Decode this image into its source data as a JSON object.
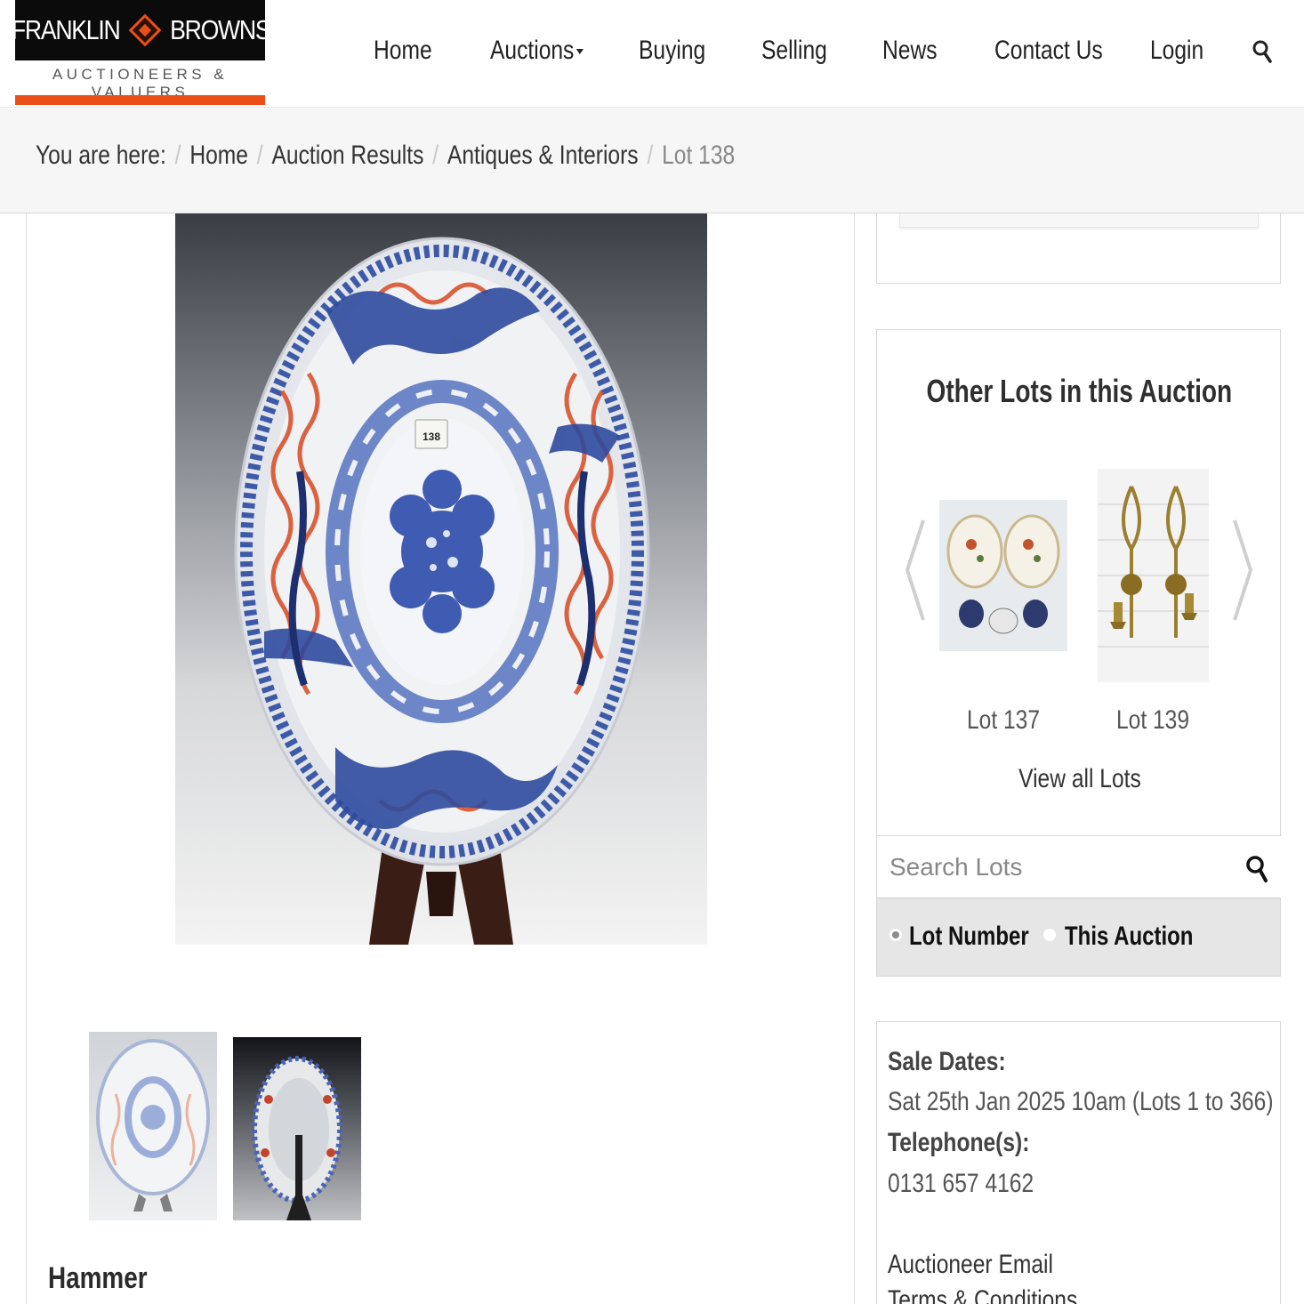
{
  "brand": {
    "name_left": "FRANKLIN",
    "name_right": "BROWNS",
    "tagline": "AUCTIONEERS & VALUERS",
    "accent_color": "#ea4f18"
  },
  "nav": {
    "items": [
      "Home",
      "Auctions",
      "Buying",
      "Selling",
      "News",
      "Contact Us",
      "Login"
    ],
    "search_icon": "search-icon"
  },
  "breadcrumb": {
    "prefix": "You are here:",
    "items": [
      "Home",
      "Auction Results",
      "Antiques & Interiors"
    ],
    "current": "Lot 138"
  },
  "lot": {
    "tag_number": "138",
    "hammer_label": "Hammer"
  },
  "sidebar": {
    "other_lots_title": "Other Lots in this Auction",
    "lots": [
      {
        "label": "Lot 137"
      },
      {
        "label": "Lot 139"
      }
    ],
    "view_all": "View all Lots",
    "search_placeholder": "Search Lots",
    "radio_options": [
      {
        "label": "Lot Number",
        "checked": true
      },
      {
        "label": "This Auction",
        "checked": false
      }
    ]
  },
  "sale_info": {
    "sale_dates_label": "Sale Dates:",
    "sale_dates_value": "Sat 25th Jan 2025 10am (Lots 1 to 366)",
    "telephone_label": "Telephone(s):",
    "telephone_value": "0131 657 4162",
    "email_link": "Auctioneer Email",
    "terms_link": "Terms & Conditions"
  }
}
